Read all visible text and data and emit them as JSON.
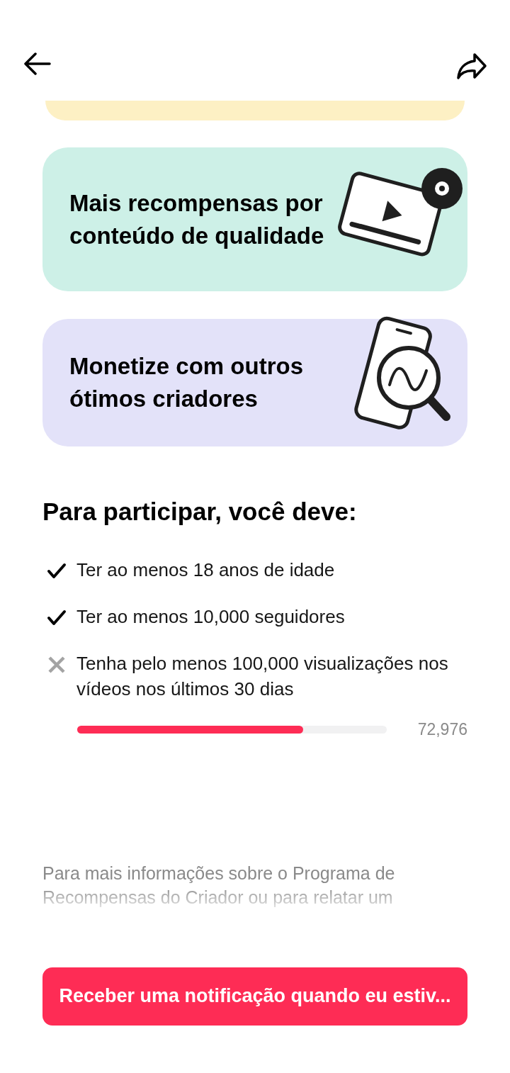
{
  "feature_cards": [
    {
      "kind": "partial",
      "color": "#fdf0c4"
    },
    {
      "kind": "video",
      "title": "Mais recompensas por conteúdo de qualidade",
      "color": "#cdf0e7"
    },
    {
      "kind": "search",
      "title": "Monetize com outros ótimos criadores",
      "color": "#e3e2f9"
    }
  ],
  "requirements_heading": "Para participar, você deve:",
  "requirements": [
    {
      "text": "Ter ao menos 18 anos de idade",
      "met": true
    },
    {
      "text": "Ter ao menos 10,000 seguidores",
      "met": true
    },
    {
      "text": "Tenha pelo menos 100,000 visualizações nos vídeos nos últimos 30 dias",
      "met": false,
      "progress": {
        "level": 0.73,
        "reading": "72,976"
      }
    }
  ],
  "info_text": "Para mais informações sobre o Programa de Recompensas do Criador ou para relatar um",
  "notify_button": "Receber uma notificação quando eu estiv..."
}
